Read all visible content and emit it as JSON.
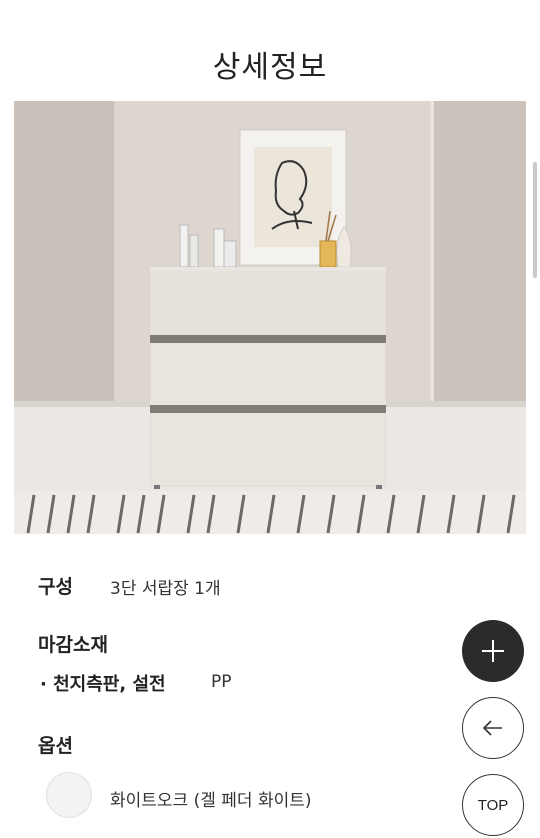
{
  "page": {
    "title": "상세정보"
  },
  "specs": {
    "composition_label": "구성",
    "composition_value": "3단 서랍장 1개",
    "finish_label": "마감소재",
    "finish_item_label": "· 천지측판, 설전",
    "finish_item_value": "PP",
    "option_label": "옵션",
    "option_name": "화이트오크 (겔 페더 화이트)"
  },
  "floating": {
    "top_label": "TOP"
  },
  "icons": [
    "plus-icon",
    "arrow-left-icon"
  ],
  "colors": {
    "dark_button": "#2b2b2b",
    "swatch": "#f3f3f3"
  }
}
